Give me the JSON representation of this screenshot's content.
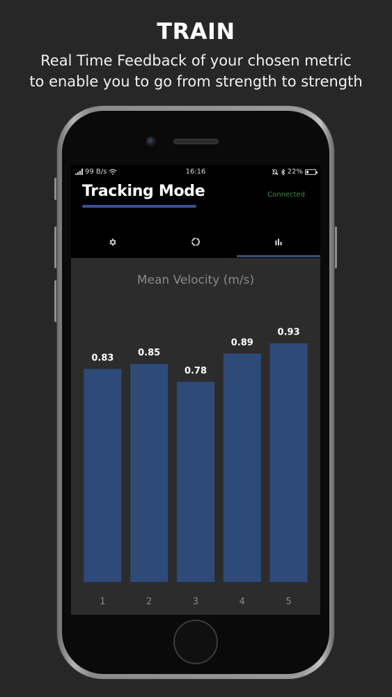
{
  "promo": {
    "title": "TRAIN",
    "subtitle_line1": "Real Time Feedback of your chosen metric",
    "subtitle_line2": "to enable you to go from strength to strength"
  },
  "status_bar": {
    "network_speed": "99 B/s",
    "time": "16:16",
    "battery": "22%"
  },
  "app": {
    "title": "Tracking Mode",
    "connection_status": "Connected",
    "accent_color": "#3a5393",
    "connected_color": "#3f8f4b"
  },
  "tabs": [
    {
      "icon": "gear-icon",
      "active": false
    },
    {
      "icon": "circle-progress-icon",
      "active": false
    },
    {
      "icon": "bar-chart-icon",
      "active": true
    }
  ],
  "chart_data": {
    "type": "bar",
    "title": "Mean Velocity (m/s)",
    "categories": [
      "1",
      "2",
      "3",
      "4",
      "5"
    ],
    "values": [
      0.83,
      0.85,
      0.78,
      0.89,
      0.93
    ],
    "value_labels": [
      "0.83",
      "0.85",
      "0.78",
      "0.89",
      "0.93"
    ],
    "bar_color": "#2e4a79",
    "ylim": [
      0.0,
      1.1
    ],
    "grid": false
  }
}
